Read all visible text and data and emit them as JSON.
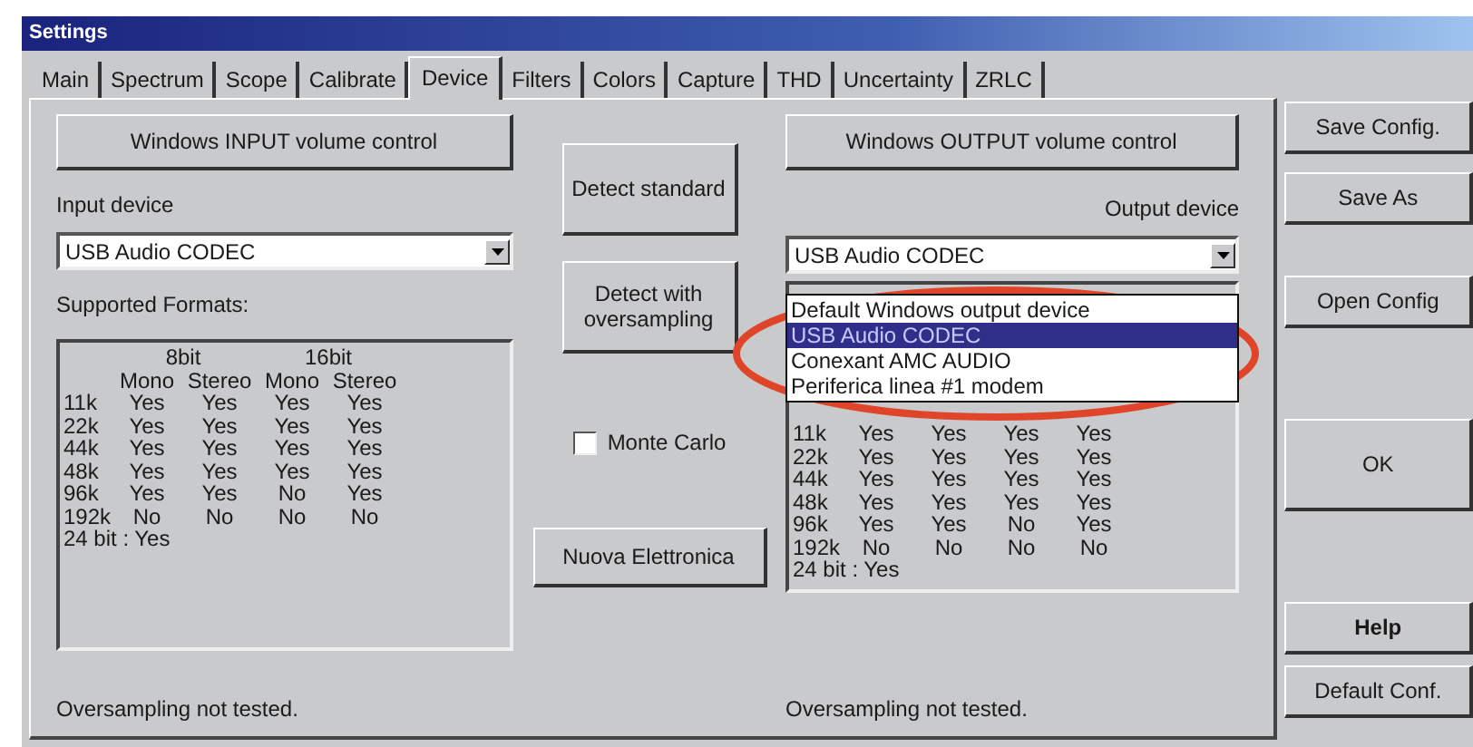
{
  "window": {
    "title": "Settings"
  },
  "tabs": [
    {
      "label": "Main",
      "selected": false
    },
    {
      "label": "Spectrum",
      "selected": false
    },
    {
      "label": "Scope",
      "selected": false
    },
    {
      "label": "Calibrate",
      "selected": false
    },
    {
      "label": "Device",
      "selected": true
    },
    {
      "label": "Filters",
      "selected": false
    },
    {
      "label": "Colors",
      "selected": false
    },
    {
      "label": "Capture",
      "selected": false
    },
    {
      "label": "THD",
      "selected": false
    },
    {
      "label": "Uncertainty",
      "selected": false
    },
    {
      "label": "ZRLC",
      "selected": false
    }
  ],
  "input": {
    "volume_button": "Windows INPUT volume control",
    "device_label": "Input device",
    "device": "USB Audio CODEC",
    "formats_label": "Supported Formats:",
    "formats": {
      "bit_headers": [
        "8bit",
        "16bit"
      ],
      "channel_headers": [
        "Mono",
        "Stereo",
        "Mono",
        "Stereo"
      ],
      "rows": [
        {
          "rate": "11k",
          "values": [
            "Yes",
            "Yes",
            "Yes",
            "Yes"
          ]
        },
        {
          "rate": "22k",
          "values": [
            "Yes",
            "Yes",
            "Yes",
            "Yes"
          ]
        },
        {
          "rate": "44k",
          "values": [
            "Yes",
            "Yes",
            "Yes",
            "Yes"
          ]
        },
        {
          "rate": "48k",
          "values": [
            "Yes",
            "Yes",
            "Yes",
            "Yes"
          ]
        },
        {
          "rate": "96k",
          "values": [
            "Yes",
            "Yes",
            "No",
            "Yes"
          ]
        },
        {
          "rate": "192k",
          "values": [
            "No",
            "No",
            "No",
            "No"
          ]
        }
      ],
      "footer": "24 bit : Yes"
    },
    "status": "Oversampling not tested."
  },
  "middle": {
    "detect_standard": "Detect standard",
    "detect_oversampling": "Detect with oversampling",
    "monte_carlo": {
      "label": "Monte Carlo",
      "checked": false
    },
    "nuova_button": "Nuova Elettronica"
  },
  "output": {
    "volume_button": "Windows OUTPUT volume control",
    "device_label": "Output device",
    "device": "USB Audio CODEC",
    "dropdown": [
      {
        "label": "Default Windows output device",
        "selected": false
      },
      {
        "label": "USB Audio CODEC",
        "selected": true
      },
      {
        "label": "Conexant AMC AUDIO",
        "selected": false
      },
      {
        "label": "Periferica linea #1 modem",
        "selected": false
      }
    ],
    "formats": {
      "rows": [
        {
          "rate": "11k",
          "values": [
            "Yes",
            "Yes",
            "Yes",
            "Yes"
          ]
        },
        {
          "rate": "22k",
          "values": [
            "Yes",
            "Yes",
            "Yes",
            "Yes"
          ]
        },
        {
          "rate": "44k",
          "values": [
            "Yes",
            "Yes",
            "Yes",
            "Yes"
          ]
        },
        {
          "rate": "48k",
          "values": [
            "Yes",
            "Yes",
            "Yes",
            "Yes"
          ]
        },
        {
          "rate": "96k",
          "values": [
            "Yes",
            "Yes",
            "No",
            "Yes"
          ]
        },
        {
          "rate": "192k",
          "values": [
            "No",
            "No",
            "No",
            "No"
          ]
        }
      ],
      "footer": "24 bit : Yes"
    },
    "status": "Oversampling not tested."
  },
  "side_buttons": [
    {
      "label": "Save Config.",
      "kind": "normal"
    },
    {
      "label": "Save As",
      "kind": "normal"
    },
    {
      "label": "Open Config",
      "kind": "normal"
    },
    {
      "label": "OK",
      "kind": "tall"
    },
    {
      "label": "Help",
      "kind": "bold"
    },
    {
      "label": "Default Conf.",
      "kind": "normal"
    }
  ]
}
